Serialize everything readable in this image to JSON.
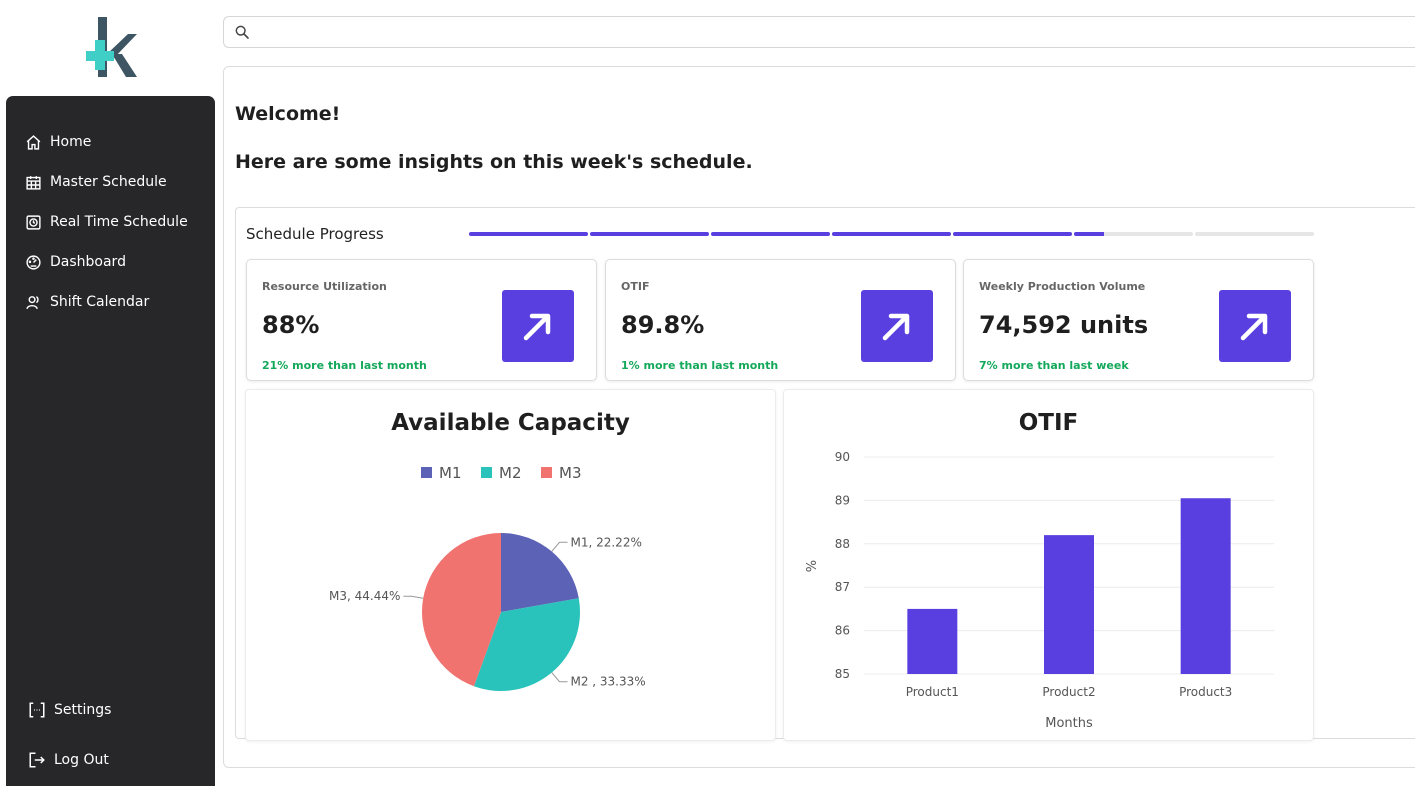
{
  "app": {
    "brand_color": "#5a3fe0",
    "logo": "k-logo"
  },
  "search": {
    "placeholder": "",
    "value": ""
  },
  "sidebar": {
    "items": [
      {
        "label": "Home",
        "icon": "home-icon"
      },
      {
        "label": "Master Schedule",
        "icon": "calendar-grid-icon"
      },
      {
        "label": "Real Time Schedule",
        "icon": "realtime-icon"
      },
      {
        "label": "Dashboard",
        "icon": "gauge-icon"
      },
      {
        "label": "Shift Calendar",
        "icon": "users-icon"
      }
    ],
    "bottom": [
      {
        "label": "Settings",
        "icon": "settings-bracket-icon"
      },
      {
        "label": "Log Out",
        "icon": "logout-icon"
      }
    ]
  },
  "main": {
    "welcome": "Welcome!",
    "subheading": "Here are some insights on this week's schedule."
  },
  "progress": {
    "label": "Schedule Progress",
    "segments_total": 7,
    "segments_filled": 5.25,
    "fill_color": "#5a3fe0"
  },
  "kpis": [
    {
      "label": "Resource Utilization",
      "value": "88%",
      "delta": "21% more than last month",
      "icon": "arrow-up-right-icon"
    },
    {
      "label": "OTIF",
      "value": "89.8%",
      "delta": "1% more than last month",
      "icon": "arrow-up-right-icon"
    },
    {
      "label": "Weekly Production Volume",
      "value": "74,592 units",
      "delta": "7% more than last week",
      "icon": "arrow-up-right-icon"
    }
  ],
  "chart_data": [
    {
      "type": "pie",
      "title": "Available Capacity",
      "legend_position": "top",
      "labels": [
        "M1",
        "M2",
        "M3"
      ],
      "values": [
        22.22,
        33.33,
        44.44
      ],
      "data_labels": [
        "M1, 22.22%",
        "M2 , 33.33%",
        "M3, 44.44%"
      ],
      "colors": [
        "#5c62b5",
        "#29c3bc",
        "#f07370"
      ]
    },
    {
      "type": "bar",
      "title": "OTIF",
      "categories": [
        "Product1",
        "Product2",
        "Product3"
      ],
      "values": [
        86.5,
        88.2,
        89.05
      ],
      "xlabel": "Months",
      "ylabel": "%",
      "ylim": [
        85,
        90
      ],
      "yticks": [
        "85",
        "86",
        "87",
        "88",
        "89",
        "90"
      ],
      "grid": true,
      "color": "#5a3fe0"
    }
  ]
}
